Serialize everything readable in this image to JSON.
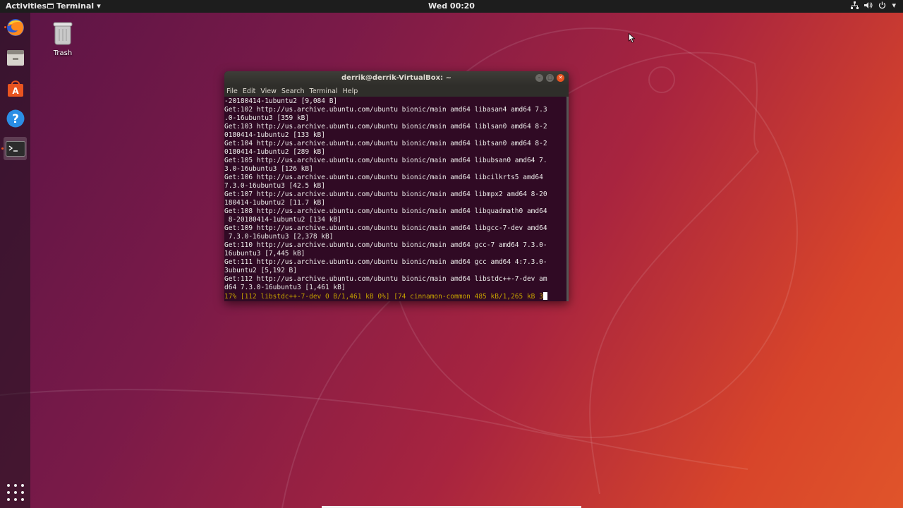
{
  "topbar": {
    "activities": "Activities",
    "app_name": "Terminal",
    "app_menu_arrow": "▾",
    "clock": "Wed 00:20",
    "tray": {
      "network_icon": "network-icon",
      "volume_icon": "volume-icon",
      "power_icon": "power-icon",
      "menu_arrow": "▾"
    }
  },
  "dock": {
    "items": [
      {
        "name": "firefox",
        "icon": "firefox-icon"
      },
      {
        "name": "files",
        "icon": "files-icon"
      },
      {
        "name": "software",
        "icon": "software-center-icon"
      },
      {
        "name": "help",
        "icon": "help-icon",
        "glyph": "?"
      },
      {
        "name": "terminal",
        "icon": "terminal-icon",
        "glyph": ">_",
        "active": true
      }
    ],
    "apps_grid_icon": "show-applications-icon"
  },
  "desktop": {
    "trash_label": "Trash"
  },
  "terminal": {
    "title": "derrik@derrik-VirtualBox: ~",
    "menu": [
      "File",
      "Edit",
      "View",
      "Search",
      "Terminal",
      "Help"
    ],
    "lines": [
      "-20180414-1ubuntu2 [9,084 B]",
      "Get:102 http://us.archive.ubuntu.com/ubuntu bionic/main amd64 libasan4 amd64 7.3",
      ".0-16ubuntu3 [359 kB]",
      "Get:103 http://us.archive.ubuntu.com/ubuntu bionic/main amd64 liblsan0 amd64 8-2",
      "0180414-1ubuntu2 [133 kB]",
      "Get:104 http://us.archive.ubuntu.com/ubuntu bionic/main amd64 libtsan0 amd64 8-2",
      "0180414-1ubuntu2 [289 kB]",
      "Get:105 http://us.archive.ubuntu.com/ubuntu bionic/main amd64 libubsan0 amd64 7.",
      "3.0-16ubuntu3 [126 kB]",
      "Get:106 http://us.archive.ubuntu.com/ubuntu bionic/main amd64 libcilkrts5 amd64",
      "7.3.0-16ubuntu3 [42.5 kB]",
      "Get:107 http://us.archive.ubuntu.com/ubuntu bionic/main amd64 libmpx2 amd64 8-20",
      "180414-1ubuntu2 [11.7 kB]",
      "Get:108 http://us.archive.ubuntu.com/ubuntu bionic/main amd64 libquadmath0 amd64",
      " 8-20180414-1ubuntu2 [134 kB]",
      "Get:109 http://us.archive.ubuntu.com/ubuntu bionic/main amd64 libgcc-7-dev amd64",
      " 7.3.0-16ubuntu3 [2,378 kB]",
      "Get:110 http://us.archive.ubuntu.com/ubuntu bionic/main amd64 gcc-7 amd64 7.3.0-",
      "16ubuntu3 [7,445 kB]",
      "Get:111 http://us.archive.ubuntu.com/ubuntu bionic/main amd64 gcc amd64 4:7.3.0-",
      "3ubuntu2 [5,192 B]",
      "Get:112 http://us.archive.ubuntu.com/ubuntu bionic/main amd64 libstdc++-7-dev am",
      "d64 7.3.0-16ubuntu3 [1,461 kB]"
    ],
    "status_line": "17% [112 libstdc++-7-dev 0 B/1,461 kB 0%] [74 cinnamon-common 485 kB/1,265 kB 3"
  },
  "colors": {
    "terminal_bg": "#300a24",
    "accent": "#e95420",
    "status_text": "#c4a000"
  }
}
